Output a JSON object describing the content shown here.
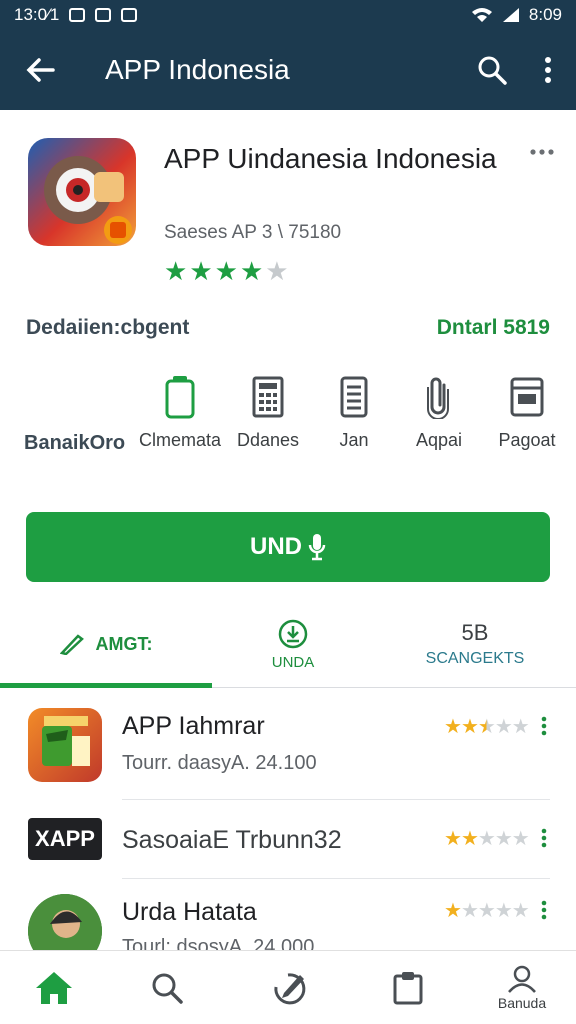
{
  "status_bar": {
    "time_left": "13:0⁄1",
    "time_right": "8:09"
  },
  "app_bar": {
    "title": "APP Indonesia"
  },
  "app": {
    "title": "APP Uindanesia Indonesia",
    "meta": "Saeses AP 3 \\ 75180",
    "rating": 4,
    "rating_max": 5,
    "developer": "Dedaiien:cbgent",
    "downloads": "Dntarl 5819"
  },
  "features": {
    "first_label": "BanaikOro",
    "items": [
      {
        "label": "Clmemata",
        "icon": "phone-icon"
      },
      {
        "label": "Ddanes",
        "icon": "calculator-icon"
      },
      {
        "label": "Jan",
        "icon": "document-icon"
      },
      {
        "label": "Aqpai",
        "icon": "paperclip-icon"
      },
      {
        "label": "Pagoat",
        "icon": "window-icon"
      }
    ]
  },
  "install_button": {
    "label": "UND"
  },
  "tabs": [
    {
      "label": "AMGT:",
      "icon": "pencil-icon"
    },
    {
      "label": "UNDA",
      "icon": "download-icon"
    },
    {
      "title": "5B",
      "label": "SCANGEKTS"
    }
  ],
  "list": [
    {
      "name": "APP Iahmrar",
      "sub": "Tourr. daasyA. 24.100",
      "rating": 2.5
    },
    {
      "name": "SasoaiaE Trbunn32",
      "sub": "",
      "rating": 2,
      "brand": "XAPP"
    },
    {
      "name": "Urda Hatata",
      "sub": "Tourl: dsosyA. 24.000",
      "rating": 1
    }
  ],
  "bottom_nav": [
    {
      "icon": "home-icon",
      "label": ""
    },
    {
      "icon": "search-icon",
      "label": ""
    },
    {
      "icon": "edit-icon",
      "label": ""
    },
    {
      "icon": "clipboard-icon",
      "label": ""
    },
    {
      "icon": "account-icon",
      "label": "Banuda"
    }
  ],
  "colors": {
    "app_bar": "#1c3a4f",
    "accent_green": "#1e9e42",
    "star_yellow": "#f2b01e"
  }
}
